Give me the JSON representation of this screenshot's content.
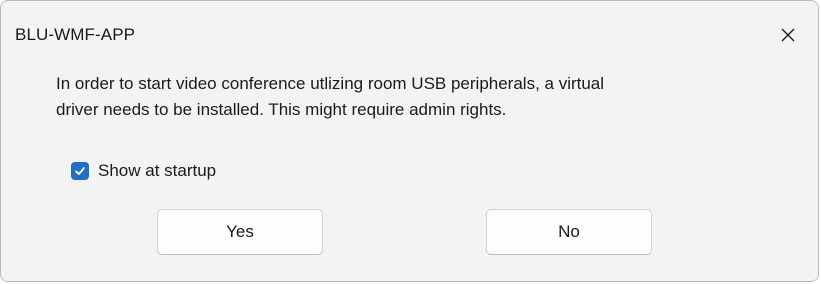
{
  "window": {
    "title": "BLU-WMF-APP",
    "close_icon": "close-icon"
  },
  "dialog": {
    "message_line1": "In order to start video conference utlizing room USB peripherals, a virtual",
    "message_line2": "driver needs to be installed. This might require admin rights.",
    "checkbox": {
      "label": "Show at startup",
      "checked": true,
      "icon": "checkmark-icon"
    },
    "buttons": {
      "yes_label": "Yes",
      "no_label": "No"
    }
  },
  "colors": {
    "accent": "#1f6fc5",
    "background": "#f3f3f3",
    "button_background": "#fdfdfd",
    "text": "#1a1a1a"
  }
}
